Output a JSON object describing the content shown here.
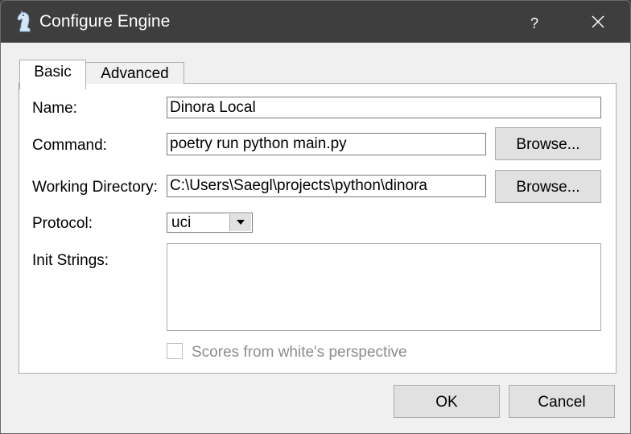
{
  "window": {
    "title": "Configure Engine",
    "help_label": "?",
    "app_icon": "chess-knight-icon"
  },
  "tabs": [
    {
      "label": "Basic",
      "active": true
    },
    {
      "label": "Advanced",
      "active": false
    }
  ],
  "form": {
    "name_label": "Name:",
    "name_value": "Dinora Local",
    "command_label": "Command:",
    "command_value": "poetry run python main.py",
    "workdir_label": "Working Directory:",
    "workdir_value": "C:\\Users\\Saegl\\projects\\python\\dinora",
    "browse_label": "Browse...",
    "protocol_label": "Protocol:",
    "protocol_value": "uci",
    "init_label": "Init Strings:",
    "init_value": "",
    "scores_label": "Scores from white's perspective",
    "scores_checked": false
  },
  "buttons": {
    "ok": "OK",
    "cancel": "Cancel"
  },
  "colors": {
    "titlebar": "#3e3e3e",
    "dialog": "#f0f0f0",
    "button": "#e1e1e1",
    "disabled_text": "#8d8d8d"
  }
}
